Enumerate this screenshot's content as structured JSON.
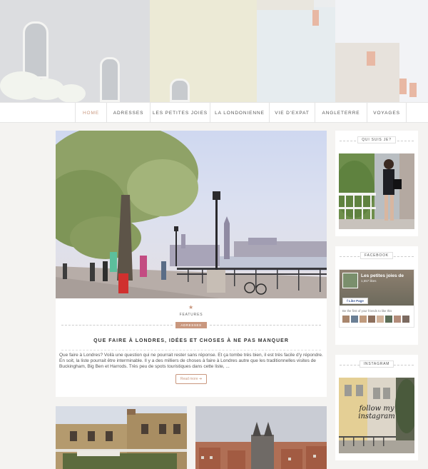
{
  "nav": {
    "items": [
      {
        "label": "HOME"
      },
      {
        "label": "ADRESSES"
      },
      {
        "label": "LES PETITES JOIES"
      },
      {
        "label": "LA LONDONIENNE"
      },
      {
        "label": "VIE D'EXPAT"
      },
      {
        "label": "ANGLETERRE"
      },
      {
        "label": "VOYAGES"
      }
    ],
    "active_color": "#c9977e"
  },
  "post": {
    "category": "FEATURES",
    "tag": "ADRESSES",
    "title": "QUE FAIRE À LONDRES, IDÉES ET CHOSES À NE PAS MANQUER",
    "excerpt": "Que faire à Londres? Voilà une question qui ne pourrait rester sans réponse. Et ça tombe très bien, il est très facile d'y répondre. En soit, la liste pourrait être interminable. Il y a des milliers de choses à faire à Londres autre que les traditionnelles visites de Buckingham, Big Ben et Harrods. Très peu de spots touristiques dans cette liste, ...",
    "read_more": "Read more"
  },
  "sidebar": {
    "about_title": "QUI SUIS JE?",
    "facebook_title": "FACEBOOK",
    "facebook": {
      "page_name": "Les petites joies de",
      "likes": "1,557 likes",
      "like_button": "Like Page",
      "friends_text": "Be the first of your friends to like this"
    },
    "instagram_title": "INSTAGRAM",
    "instagram_overlay": "follow my instagram"
  },
  "colors": {
    "accent": "#c9977e",
    "background": "#f4f3f1"
  }
}
